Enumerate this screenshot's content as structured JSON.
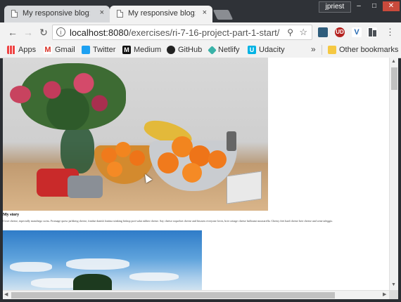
{
  "tabs": [
    {
      "title": "My responsive blog: pictu",
      "close": "×"
    },
    {
      "title": "My responsive blog: pictu",
      "close": "×"
    }
  ],
  "user": "jpriest",
  "window_controls": {
    "minimize": "–",
    "maximize": "□",
    "close": "✕"
  },
  "toolbar": {
    "back": "←",
    "forward": "→",
    "reload": "↻",
    "url_host": "localhost:8080",
    "url_path": "/exercises/ri-7-16-project-part-1-start/",
    "info": "i",
    "zoom": "⚲",
    "star": "☆",
    "menu": "⋮",
    "extensions": [
      "",
      "UD",
      "V",
      ""
    ]
  },
  "bookmarks": [
    {
      "label": "Apps",
      "icon": "apps-icon"
    },
    {
      "label": "Gmail",
      "icon": "gmail-icon"
    },
    {
      "label": "Twitter",
      "icon": "twitter-icon"
    },
    {
      "label": "Medium",
      "icon": "medium-icon"
    },
    {
      "label": "GitHub",
      "icon": "github-icon"
    },
    {
      "label": "Netlify",
      "icon": "netlify-icon"
    },
    {
      "label": "Udacity",
      "icon": "udacity-icon"
    }
  ],
  "bookmarks_more": "»",
  "other_bookmarks": "Other bookmarks",
  "page": {
    "story_title": "My story",
    "story_text": "I love cheese, especially manchego swiss. Fromage queso jarlsberg cheese, fondue danish fontina stinking bishop port-salut rubber cheese. Say cheese roquefort cheese and biscuits everyone loves, brie cottage cheese halloumi mozzarella. Cheesy feet hard cheese brie cheese and wine taleggio."
  },
  "scroll": {
    "up": "▲",
    "down": "▼",
    "left": "◀",
    "right": "▶"
  }
}
